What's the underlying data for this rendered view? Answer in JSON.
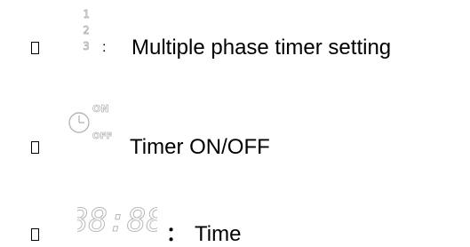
{
  "items": [
    {
      "bullet": "",
      "icon": "phase-numbers-icon",
      "icon_text": [
        "1",
        "2",
        "3"
      ],
      "separator": ":",
      "label": "Multiple phase timer setting"
    },
    {
      "bullet": "",
      "icon": "timer-clock-icon",
      "icon_text": [
        "ON",
        "OFF"
      ],
      "separator": "",
      "label": "Timer ON/OFF"
    },
    {
      "bullet": "",
      "icon": "seven-segment-time-icon",
      "icon_text": [
        "88:88"
      ],
      "separator": "：",
      "label": "Time"
    }
  ],
  "colors": {
    "text": "#000000",
    "icon_stroke": "#b8b8b8"
  }
}
